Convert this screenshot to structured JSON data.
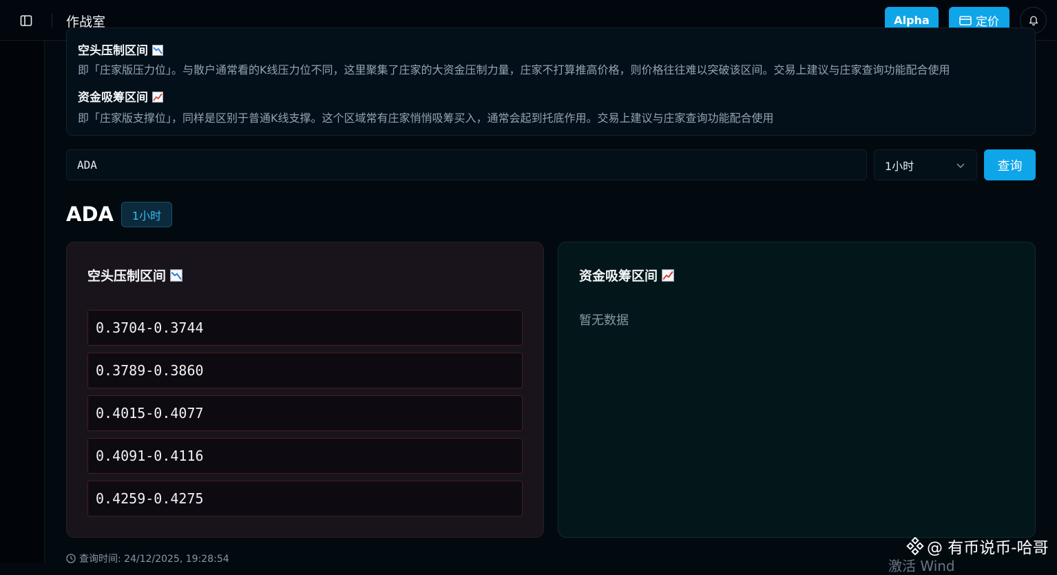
{
  "header": {
    "app_title": "作战室",
    "alpha_label": "Alpha",
    "pricing_label": "定价"
  },
  "info": {
    "bear_title": "空头压制区间",
    "bear_desc": "即「庄家版压力位」。与散户通常看的K线压力位不同，这里聚集了庄家的大资金压制力量，庄家不打算推高价格，则价格往往难以突破该区间。交易上建议与庄家查询功能配合使用",
    "bull_title": "资金吸筹区间",
    "bull_desc": "即「庄家版支撑位」，同样是区别于普通K线支撑。这个区域常有庄家悄悄吸筹买入，通常会起到托底作用。交易上建议与庄家查询功能配合使用"
  },
  "search": {
    "value": "ADA",
    "timeframe": "1小时",
    "query_label": "查询"
  },
  "result": {
    "symbol": "ADA",
    "timeframe_badge": "1小时",
    "bear_panel_title": "空头压制区间",
    "bull_panel_title": "资金吸筹区间",
    "bear_zones": [
      "0.3704-0.3744",
      "0.3789-0.3860",
      "0.4015-0.4077",
      "0.4091-0.4116",
      "0.4259-0.4275"
    ],
    "bull_empty": "暂无数据",
    "query_time": "查询时间: 24/12/2025, 19:28:54"
  },
  "overlay": {
    "watermark": "@ 有币说币-哈哥",
    "activate": "激活 Wind"
  },
  "colors": {
    "accent": "#0ea5e9",
    "bear_border": "#4a1c22",
    "background": "#020a10"
  }
}
